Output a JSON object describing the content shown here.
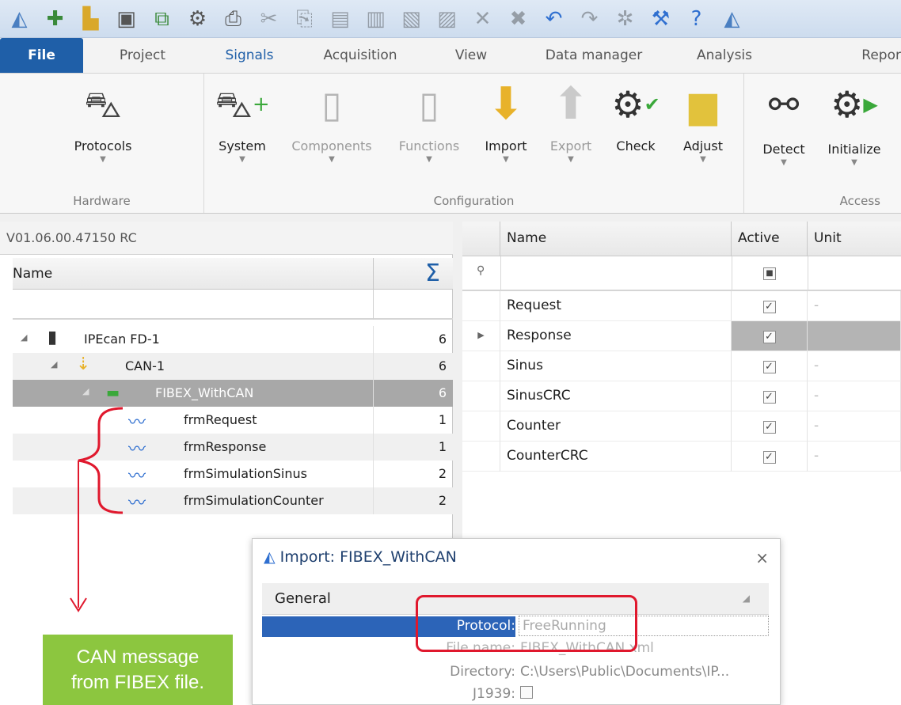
{
  "quick_access_toolbar": {
    "icons": [
      "app-icon",
      "new-icon",
      "open-folder-icon",
      "save-icon",
      "save-all-icon",
      "export-icon",
      "auto-icon",
      "print-icon",
      "cut-icon",
      "copy-icon",
      "paste-icon",
      "paste-special-icon",
      "copy-format-icon",
      "paste-format-icon",
      "delete-icon",
      "delete-all-icon",
      "undo-icon",
      "redo-icon",
      "settings-icon",
      "tools-icon",
      "help-icon",
      "about-icon"
    ]
  },
  "tabs": [
    {
      "label": "File"
    },
    {
      "label": "Project"
    },
    {
      "label": "Signals"
    },
    {
      "label": "Acquisition"
    },
    {
      "label": "View"
    },
    {
      "label": "Data manager"
    },
    {
      "label": "Analysis"
    },
    {
      "label": "Repor"
    }
  ],
  "ribbon": {
    "groups": {
      "hardware": "Hardware",
      "configuration": "Configuration",
      "access": "Access"
    },
    "buttons": {
      "protocols": "Protocols",
      "system": "System",
      "components": "Components",
      "functions": "Functions",
      "import": "Import",
      "export": "Export",
      "check": "Check",
      "adjust": "Adjust",
      "detect": "Detect",
      "initialize": "Initialize"
    }
  },
  "left_pane": {
    "version": "V01.06.00.47150 RC",
    "header_name": "Name",
    "header_sum": "Σ",
    "tree": [
      {
        "label": "IPEcan FD-1",
        "count": "6"
      },
      {
        "label": "CAN-1",
        "count": "6"
      },
      {
        "label": "FIBEX_WithCAN",
        "count": "6"
      },
      {
        "label": "frmRequest",
        "count": "1"
      },
      {
        "label": "frmResponse",
        "count": "1"
      },
      {
        "label": "frmSimulationSinus",
        "count": "2"
      },
      {
        "label": "frmSimulationCounter",
        "count": "2"
      }
    ]
  },
  "right_pane": {
    "headers": {
      "name": "Name",
      "active": "Active",
      "unit": "Unit"
    },
    "rows": [
      {
        "name": "Request",
        "unit": "-"
      },
      {
        "name": "Response",
        "unit": ""
      },
      {
        "name": "Sinus",
        "unit": "-"
      },
      {
        "name": "SinusCRC",
        "unit": "-"
      },
      {
        "name": "Counter",
        "unit": "-"
      },
      {
        "name": "CounterCRC",
        "unit": "-"
      }
    ]
  },
  "dialog": {
    "title": "Import: FIBEX_WithCAN",
    "close": "×",
    "section": "General",
    "protocol_label": "Protocol:",
    "protocol_value": "FreeRunning",
    "file_label": "File name:",
    "file_value": "FIBEX_WithCAN.xml",
    "dir_label": "Directory:",
    "dir_value": "C:\\Users\\Public\\Documents\\IP...",
    "j1939_label": "J1939:"
  },
  "annotation": {
    "callout_line1": "CAN message",
    "callout_line2": "from FIBEX file.",
    "accent_red": "#e0182d",
    "callout_green": "#8cc63f"
  }
}
